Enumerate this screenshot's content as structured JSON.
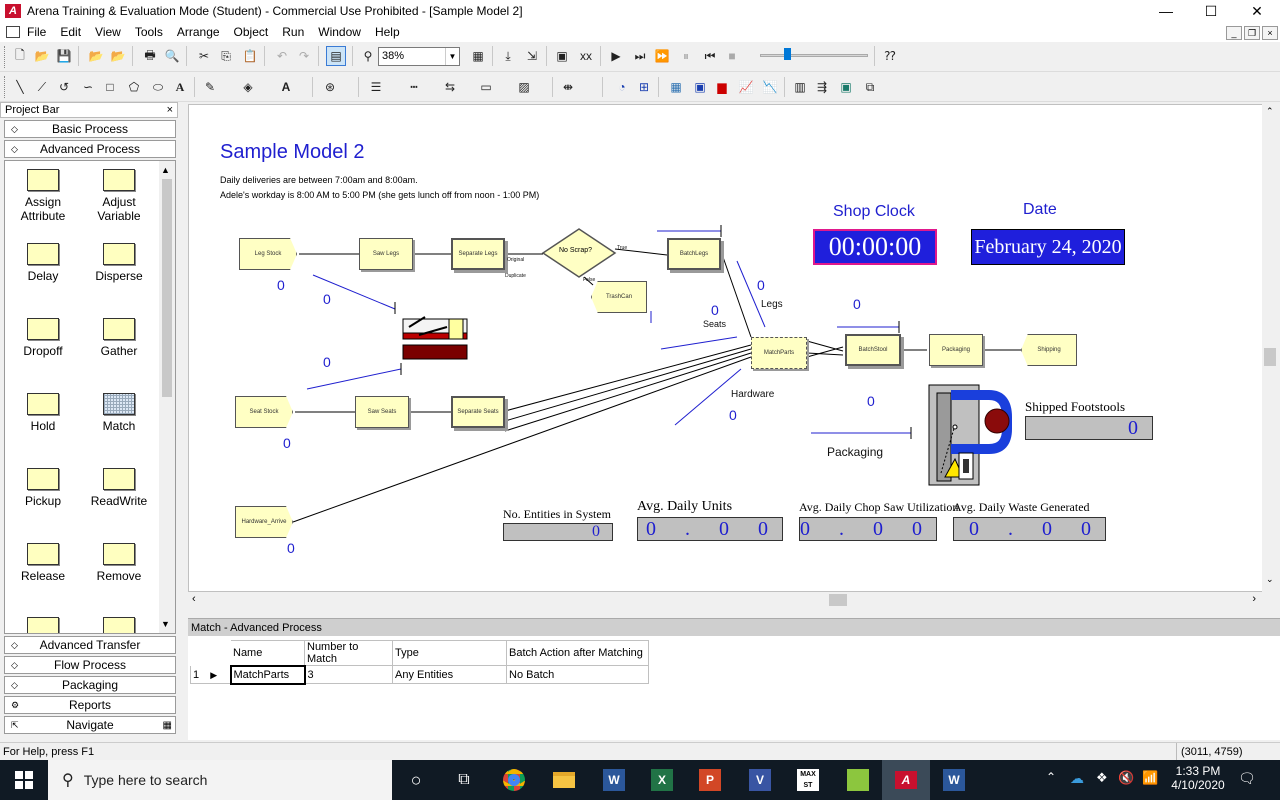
{
  "window": {
    "title": "Arena Training & Evaluation Mode (Student) - Commercial Use Prohibited - [Sample Model 2]",
    "app_icon_letter": "A",
    "min_symbol": "—",
    "max_symbol": "☐",
    "close_symbol": "✕"
  },
  "menu": [
    "File",
    "Edit",
    "View",
    "Tools",
    "Arrange",
    "Object",
    "Run",
    "Window",
    "Help"
  ],
  "toolbar": {
    "zoom_value": "38%"
  },
  "project_bar": {
    "title": "Project Bar",
    "close": "×",
    "panels_top": [
      "Basic Process",
      "Advanced Process"
    ],
    "modules": [
      {
        "label": "Assign\nAttribute"
      },
      {
        "label": "Adjust\nVariable"
      },
      {
        "label": "Delay"
      },
      {
        "label": "Disperse"
      },
      {
        "label": "Dropoff"
      },
      {
        "label": "Gather"
      },
      {
        "label": "Hold"
      },
      {
        "label": "Match"
      },
      {
        "label": "Pickup"
      },
      {
        "label": "ReadWrite"
      },
      {
        "label": "Release"
      },
      {
        "label": "Remove"
      }
    ],
    "panels_bottom": [
      "Advanced Transfer",
      "Flow Process",
      "Packaging",
      "Reports",
      "Navigate"
    ]
  },
  "canvas": {
    "title": "Sample Model 2",
    "note1": "Daily deliveries are between 7:00am and 8:00am.",
    "note2": "Adele's workday is 8:00 AM to 5:00 PM (she gets lunch off from noon - 1:00 PM)",
    "shop_clock_label": "Shop Clock",
    "shop_clock_value": "00:00:00",
    "date_label": "Date",
    "date_value": "February 24, 2020",
    "blocks": {
      "leg_stock": "Leg Stock",
      "saw_legs": "Saw Legs",
      "separate_legs": "Separate Legs",
      "no_scrap": "No Scrap?",
      "batch_legs": "BatchLegs",
      "trash_can": "TrashCan",
      "match_parts": "MatchParts",
      "batch_stool": "BatchStool",
      "packaging": "Packaging",
      "shipping": "Shipping",
      "seat_stock": "Seat Stock",
      "saw_seats": "Saw Seats",
      "separate_seats": "Separate Seats",
      "hardware_arrive": "Hardware_Arrive"
    },
    "small_labels": {
      "true": "True",
      "false": "False",
      "original": "Original",
      "duplicate": "Duplicate"
    },
    "queue_labels": {
      "legs": "Legs",
      "seats": "Seats",
      "hardware": "Hardware",
      "packaging": "Packaging"
    },
    "counters": {
      "leg_stock": "0",
      "saw_legs_q": "0",
      "saw_q2": "0",
      "batch_legs_q": "0",
      "legs_q": "0",
      "batch_stool_q": "0",
      "seats_q": "0",
      "seat_stock": "0",
      "hardware_q": "0",
      "hardware_arrive": "0",
      "packaging_q": "0",
      "shipping": "0",
      "trash": "0"
    },
    "stats": {
      "shipped_label": "Shipped Footstools",
      "shipped_value": "0",
      "entities_label": "No. Entities in System",
      "entities_value": "0",
      "units_label": "Avg. Daily Units",
      "units_value": "0 . 0 0",
      "chop_label": "Avg. Daily Chop Saw Utilization",
      "chop_value": "0 . 0 0",
      "waste_label": "Avg. Daily Waste Generated",
      "waste_value": "0 . 0 0"
    }
  },
  "sheet": {
    "title": "Match - Advanced Process",
    "headers": [
      "Name",
      "Number to Match",
      "Type",
      "Batch Action after Matching"
    ],
    "rows": [
      {
        "num": "1",
        "name": "MatchParts",
        "number": "3",
        "type": "Any Entities",
        "batch": "No Batch"
      }
    ]
  },
  "status": {
    "help": "For Help, press F1",
    "coords": "(3011, 4759)"
  },
  "taskbar": {
    "search_placeholder": "Type here to search",
    "time": "1:33 PM",
    "date": "4/10/2020"
  }
}
